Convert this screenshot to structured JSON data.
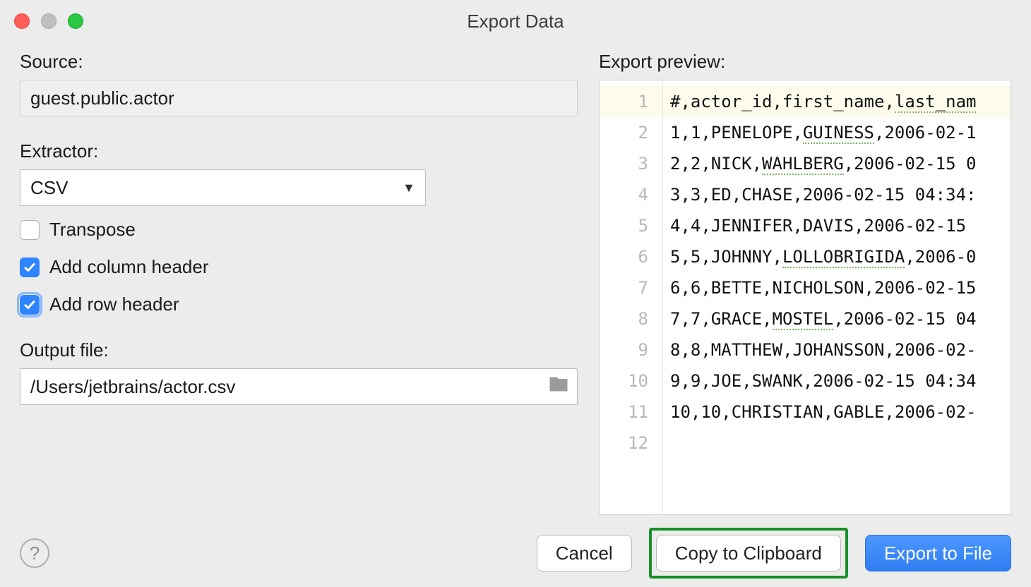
{
  "window": {
    "title": "Export Data"
  },
  "left": {
    "source_label": "Source:",
    "source_value": "guest.public.actor",
    "extractor_label": "Extractor:",
    "extractor_value": "CSV",
    "checks": {
      "transpose": "Transpose",
      "col_header": "Add column header",
      "row_header": "Add row header"
    },
    "output_label": "Output file:",
    "output_value": "/Users/jetbrains/actor.csv"
  },
  "right": {
    "preview_label": "Export preview:",
    "gutter": [
      "1",
      "2",
      "3",
      "4",
      "5",
      "6",
      "7",
      "8",
      "9",
      "10",
      "11",
      "12"
    ],
    "lines": [
      {
        "pre": "#,actor_id,first_name,",
        "sp": "last_nam",
        "post": ""
      },
      {
        "pre": "1,1,PENELOPE,",
        "sp": "GUINESS",
        "post": ",2006-02-1"
      },
      {
        "pre": "2,2,NICK,",
        "sp": "WAHLBERG",
        "post": ",2006-02-15 0"
      },
      {
        "pre": "3,3,ED,CHASE,2006-02-15 04:34:",
        "sp": "",
        "post": ""
      },
      {
        "pre": "4,4,JENNIFER,DAVIS,2006-02-15",
        "sp": "",
        "post": ""
      },
      {
        "pre": "5,5,JOHNNY,",
        "sp": "LOLLOBRIGIDA",
        "post": ",2006-0"
      },
      {
        "pre": "6,6,BETTE,NICHOLSON,2006-02-15",
        "sp": "",
        "post": ""
      },
      {
        "pre": "7,7,GRACE,",
        "sp": "MOSTEL",
        "post": ",2006-02-15 04"
      },
      {
        "pre": "8,8,MATTHEW,JOHANSSON,2006-02-",
        "sp": "",
        "post": ""
      },
      {
        "pre": "9,9,JOE,SWANK,2006-02-15 04:34",
        "sp": "",
        "post": ""
      },
      {
        "pre": "10,10,CHRISTIAN,GABLE,2006-02-",
        "sp": "",
        "post": ""
      },
      {
        "pre": "",
        "sp": "",
        "post": ""
      }
    ]
  },
  "footer": {
    "cancel": "Cancel",
    "copy": "Copy to Clipboard",
    "export": "Export to File"
  }
}
